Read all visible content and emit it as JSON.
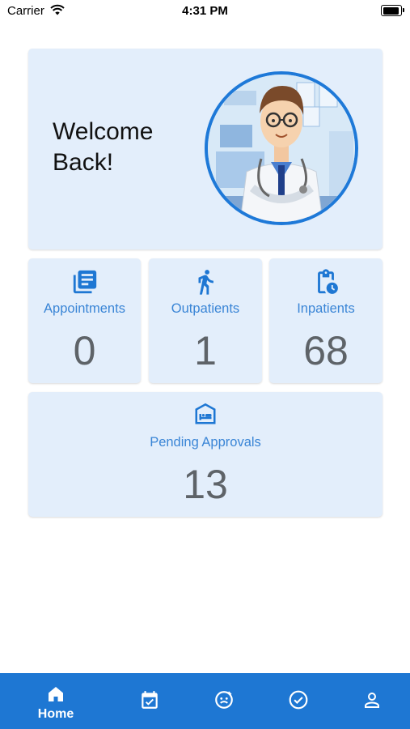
{
  "status_bar": {
    "carrier": "Carrier",
    "time": "4:31 PM"
  },
  "welcome": {
    "line1": "Welcome",
    "line2": "Back!"
  },
  "stats": [
    {
      "label": "Appointments",
      "value": "0",
      "icon": "book-icon"
    },
    {
      "label": "Outpatients",
      "value": "1",
      "icon": "walking-person-icon"
    },
    {
      "label": "Inpatients",
      "value": "68",
      "icon": "clipboard-clock-icon"
    }
  ],
  "pending": {
    "label": "Pending Approvals",
    "value": "13",
    "icon": "hospital-bed-icon"
  },
  "nav": {
    "home_label": "Home",
    "items": [
      "home-icon",
      "calendar-check-icon",
      "face-icon",
      "check-circle-icon",
      "person-icon"
    ]
  },
  "colors": {
    "accent": "#1e77d3",
    "card": "#e3eefb",
    "label": "#3a85d6",
    "value": "#5e6368"
  }
}
